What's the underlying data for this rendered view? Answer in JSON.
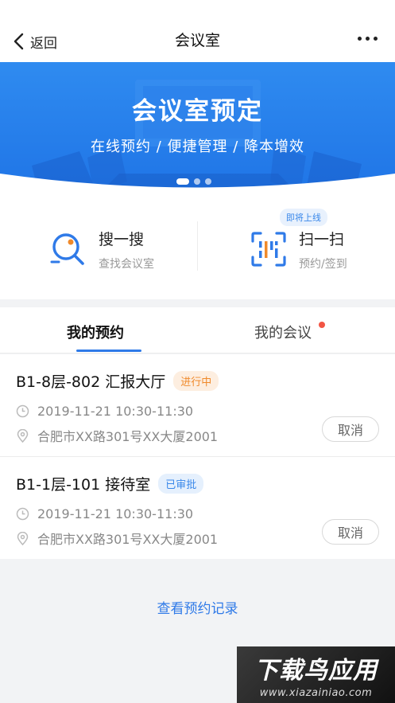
{
  "nav": {
    "back_label": "返回",
    "title": "会议室"
  },
  "banner": {
    "title": "会议室预定",
    "subtitle": "在线预约 / 便捷管理 / 降本增效",
    "active_slide": 1,
    "slide_count": 3
  },
  "features": {
    "search": {
      "title": "搜一搜",
      "desc": "查找会议室",
      "icon": "search-icon"
    },
    "scan": {
      "title": "扫一扫",
      "desc": "预约/签到",
      "icon": "scan-icon",
      "tag": "即将上线"
    }
  },
  "tabs": {
    "items": [
      "我的预约",
      "我的会议"
    ],
    "active": 0
  },
  "bookings": [
    {
      "room": "B1-8层-802 汇报大厅",
      "status": "进行中",
      "time": "2019-11-21 10:30-11:30",
      "address": "合肥市XX路301号XX大厦2001",
      "action": "取消"
    },
    {
      "room": "B1-1层-101 接待室",
      "status": "已审批",
      "time": "2019-11-21 10:30-11:30",
      "address": "合肥市XX路301号XX大厦2001",
      "action": "取消"
    }
  ],
  "history_link": "查看预约记录",
  "watermark": {
    "main": "下载鸟应用",
    "url": "www.xiazainiao.com"
  },
  "colors": {
    "accent": "#2f7ae8",
    "banner": "#1f74e6",
    "status_in_progress": "#f08a2b",
    "status_approved": "#3a88ea"
  }
}
